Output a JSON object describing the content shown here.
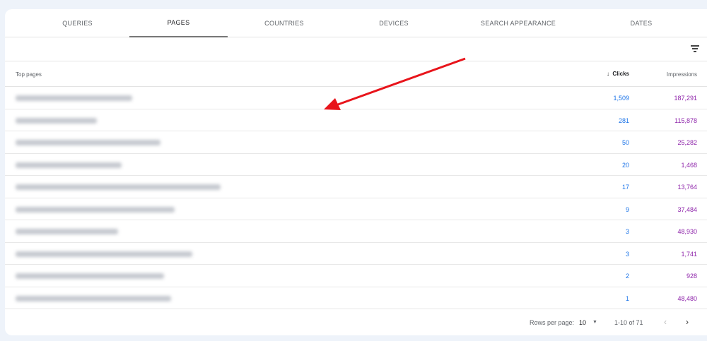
{
  "tabs": [
    "QUERIES",
    "PAGES",
    "COUNTRIES",
    "DEVICES",
    "SEARCH APPEARANCE",
    "DATES"
  ],
  "active_tab": "PAGES",
  "table": {
    "headers": {
      "page": "Top pages",
      "clicks": "Clicks",
      "impressions": "Impressions",
      "sort_icon": "arrow-down-icon"
    },
    "rows": [
      {
        "clicks": "1,509",
        "impressions": "187,291"
      },
      {
        "clicks": "281",
        "impressions": "115,878"
      },
      {
        "clicks": "50",
        "impressions": "25,282"
      },
      {
        "clicks": "20",
        "impressions": "1,468"
      },
      {
        "clicks": "17",
        "impressions": "13,764"
      },
      {
        "clicks": "9",
        "impressions": "37,484"
      },
      {
        "clicks": "3",
        "impressions": "48,930"
      },
      {
        "clicks": "3",
        "impressions": "1,741"
      },
      {
        "clicks": "2",
        "impressions": "928"
      },
      {
        "clicks": "1",
        "impressions": "48,480"
      }
    ]
  },
  "footer": {
    "rows_per_page_label": "Rows per page:",
    "rows_per_page": "10",
    "range": "1-10 of 71"
  },
  "colors": {
    "clicks": "#1a73e8",
    "impressions": "#8e24aa",
    "annotation_arrow": "#e8141b"
  }
}
